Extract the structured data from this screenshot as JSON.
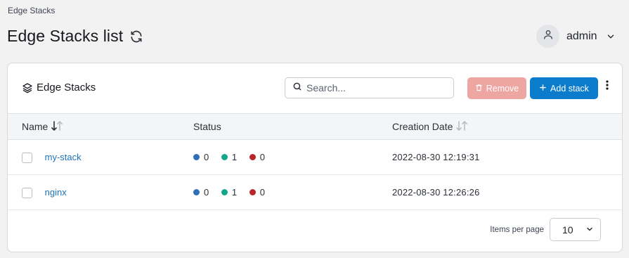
{
  "breadcrumb": "Edge Stacks",
  "page_title": "Edge Stacks list",
  "user": {
    "name": "admin"
  },
  "card": {
    "title": "Edge Stacks",
    "search_placeholder": "Search...",
    "remove_label": "Remove",
    "add_label": "Add stack"
  },
  "table": {
    "headers": {
      "name": "Name",
      "status": "Status",
      "creation_date": "Creation Date"
    },
    "rows": [
      {
        "name": "my-stack",
        "status": {
          "blue": "0",
          "green": "1",
          "red": "0"
        },
        "created": "2022-08-30 12:19:31"
      },
      {
        "name": "nginx",
        "status": {
          "blue": "0",
          "green": "1",
          "red": "0"
        },
        "created": "2022-08-30 12:26:26"
      }
    ]
  },
  "pagination": {
    "label": "Items per page",
    "value": "10"
  },
  "colors": {
    "status_blue": "#2f6fb4",
    "status_green": "#13a688",
    "status_red": "#b8262b",
    "primary": "#0b7ccb",
    "danger_disabled": "#eea6a3"
  },
  "icons": [
    "refresh-icon",
    "user-icon",
    "chevron-down-icon",
    "layers-icon",
    "search-icon",
    "trash-icon",
    "plus-icon",
    "kebab-icon",
    "sort-icon"
  ]
}
